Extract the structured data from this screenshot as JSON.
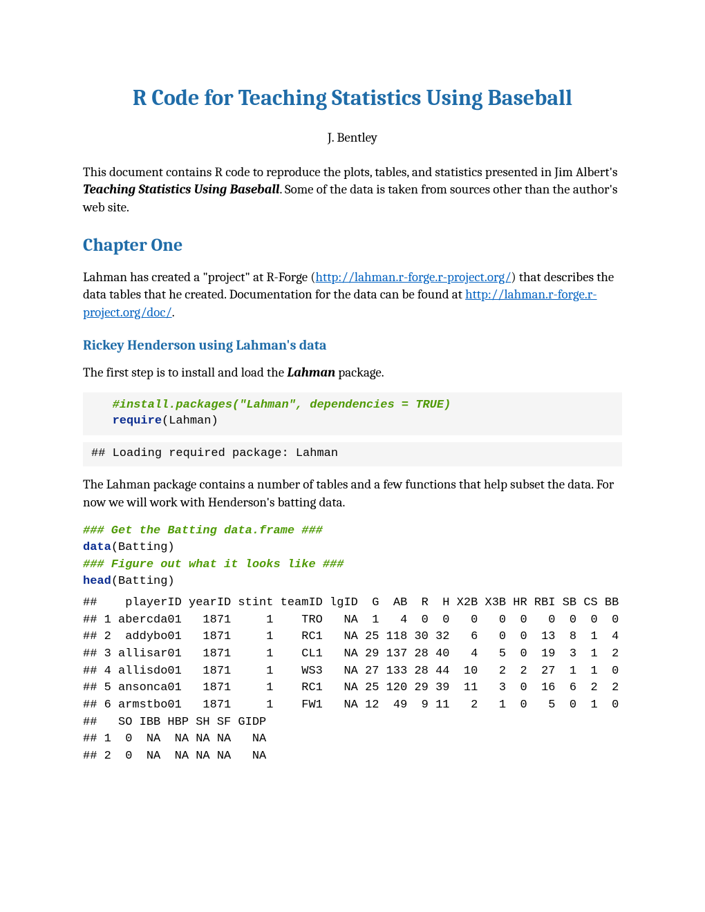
{
  "title": "R Code for Teaching Statistics Using Baseball",
  "author": "J. Bentley",
  "intro_part1": "This document contains R code to reproduce the plots, tables, and statistics presented in Jim Albert's ",
  "intro_book": "Teaching Statistics Using Baseball",
  "intro_part2": ". Some of the data is taken from sources other than the author's web site.",
  "chapter": "Chapter One",
  "p1_part1": "Lahman has created a \"project\" at R-Forge (",
  "p1_link1": "http://lahman.r-forge.r-project.org/",
  "p1_part2": ") that describes the data tables that he created. Documentation for the data can be found at ",
  "p1_link2": "http://lahman.r-forge.r-project.org/doc/",
  "p1_part3": ".",
  "subsection": "Rickey Henderson using Lahman's data",
  "p2_part1": "The first step is to install and load the ",
  "p2_pkg": "Lahman",
  "p2_part2": " package.",
  "code1_comment": "#install.packages(\"Lahman\", dependencies = TRUE)",
  "code1_keyword": "require",
  "code1_args": "(Lahman)",
  "output1": "## Loading required package: Lahman",
  "p3": "The Lahman package contains a number of tables and a few functions that help subset the data. For now we will work with Henderson's batting data.",
  "code2_comment1": "### Get the Batting data.frame ###",
  "code2_k1": "data",
  "code2_a1": "(Batting)",
  "code2_comment2": "### Figure out what it looks like ###",
  "code2_k2": "head",
  "code2_a2": "(Batting)",
  "output2": "##    playerID yearID stint teamID lgID  G  AB  R  H X2B X3B HR RBI SB CS BB\n## 1 abercda01   1871     1    TRO   NA  1   4  0  0   0   0  0   0  0  0  0\n## 2  addybo01   1871     1    RC1   NA 25 118 30 32   6   0  0  13  8  1  4\n## 3 allisar01   1871     1    CL1   NA 29 137 28 40   4   5  0  19  3  1  2\n## 4 allisdo01   1871     1    WS3   NA 27 133 28 44  10   2  2  27  1  1  0\n## 5 ansonca01   1871     1    RC1   NA 25 120 29 39  11   3  0  16  6  2  2\n## 6 armstbo01   1871     1    FW1   NA 12  49  9 11   2   1  0   5  0  1  0\n##   SO IBB HBP SH SF GIDP\n## 1  0  NA  NA NA NA   NA\n## 2  0  NA  NA NA NA   NA"
}
